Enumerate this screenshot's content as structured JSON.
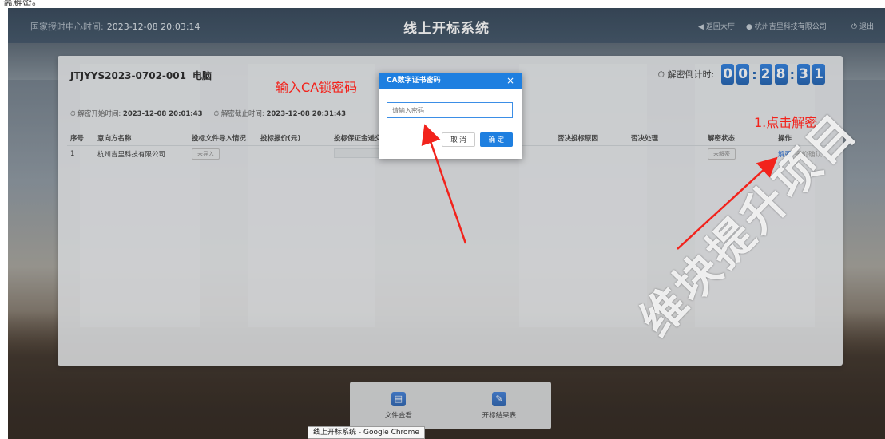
{
  "caption_top": "需解密。",
  "header": {
    "clock_label": "国家授时中心时间:",
    "clock_time": "2023-12-08 20:03:14",
    "title": "线上开标系统",
    "back_label": "返回大厅",
    "company": "杭州吉里科技有限公司",
    "logout": "退出"
  },
  "project": {
    "code": "JTJYYS2023-0702-001",
    "category": "电脑",
    "countdown_label": "解密倒计时:",
    "countdown_digits": [
      "0",
      "0",
      "2",
      "8",
      "3",
      "1"
    ],
    "decrypt_start_label": "解密开始时间:",
    "decrypt_start": "2023-12-08 20:01:43",
    "decrypt_end_label": "解密截止时间:",
    "decrypt_end": "2023-12-08 20:31:43"
  },
  "table": {
    "headers": [
      "序号",
      "意向方名称",
      "投标文件导入情况",
      "投标报价(元)",
      "投标保证金递交",
      "否决投标原因",
      "否决处理",
      "解密状态",
      "操作"
    ],
    "rows": [
      {
        "index": "1",
        "name": "杭州吉里科技有限公司",
        "import_status": "未导入",
        "price": "",
        "deposit": "",
        "reject_reason": "",
        "reject_action": "",
        "decrypt_status": "未解密",
        "action_decrypt": "解密",
        "action_confirm": "报价确认"
      }
    ]
  },
  "modal": {
    "title": "CA数字证书密码",
    "close": "×",
    "placeholder": "请输入密码",
    "cancel": "取 消",
    "confirm": "确 定"
  },
  "bottom_bar": {
    "items": [
      {
        "label": "文件查看",
        "icon": "document-icon"
      },
      {
        "label": "开标结果表",
        "icon": "edit-icon"
      }
    ]
  },
  "taskbar_tooltip": "线上开标系统 - Google Chrome",
  "annotations": {
    "enter_password": "输入CA锁密码",
    "click_decrypt": "1.点击解密",
    "watermark": "维块提升项目"
  },
  "colors": {
    "accent": "#1e7fe0",
    "annotation": "#f2231c",
    "header": "#34495e"
  }
}
